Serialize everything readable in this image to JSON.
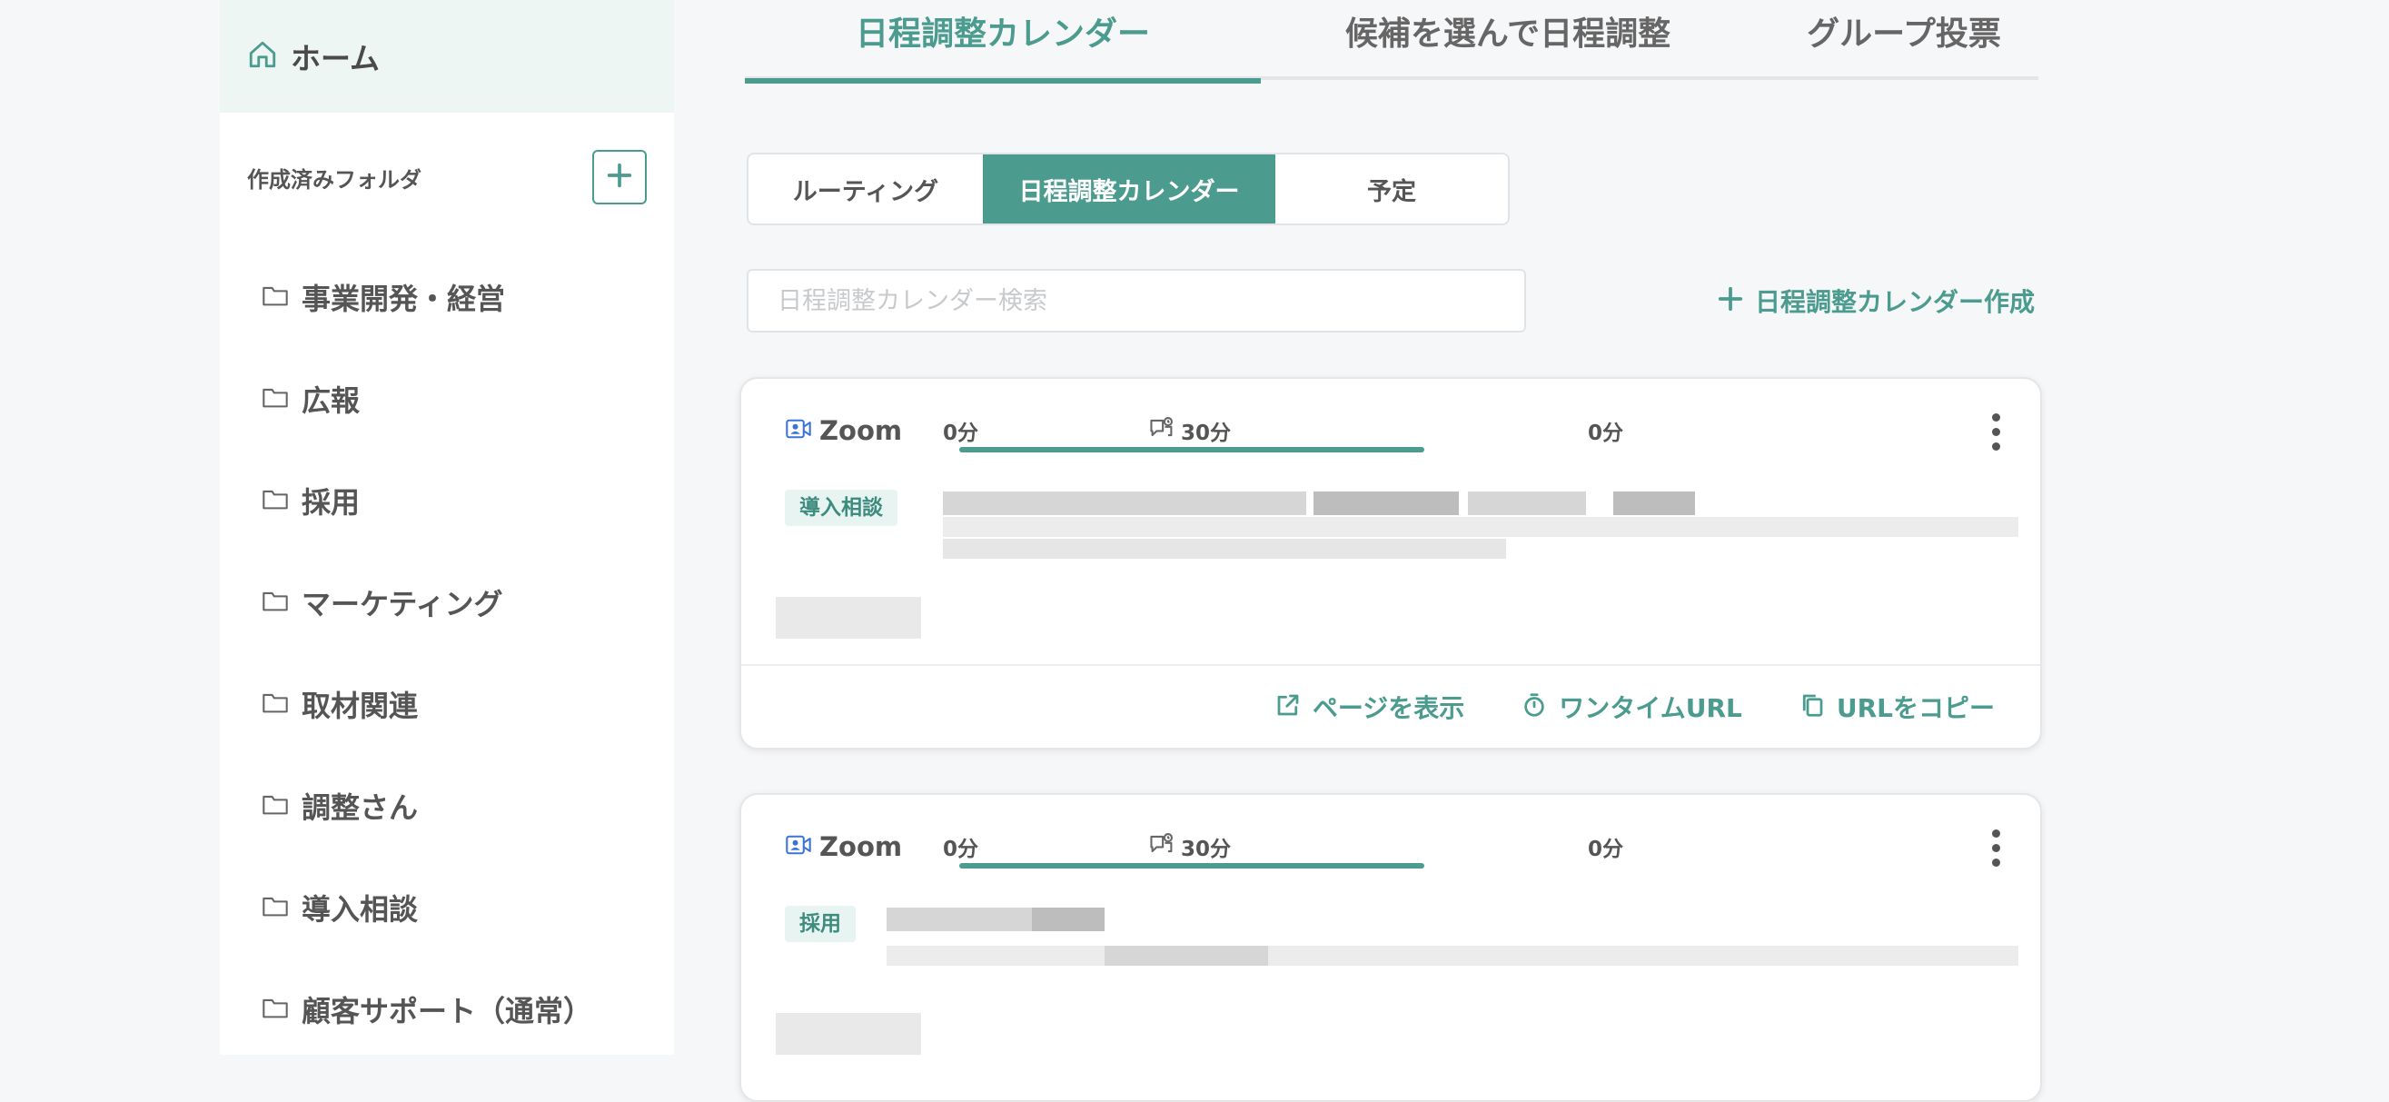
{
  "sidebar": {
    "home_label": "ホーム",
    "folders_title": "作成済みフォルダ",
    "folders": [
      {
        "label": "事業開発・経営"
      },
      {
        "label": "広報"
      },
      {
        "label": "採用"
      },
      {
        "label": "マーケティング"
      },
      {
        "label": "取材関連"
      },
      {
        "label": "調整さん"
      },
      {
        "label": "導入相談"
      },
      {
        "label": "顧客サポート（通常）"
      }
    ]
  },
  "top_tabs": [
    {
      "label": "日程調整カレンダー",
      "active": true
    },
    {
      "label": "候補を選んで日程調整",
      "active": false
    },
    {
      "label": "グループ投票",
      "active": false
    }
  ],
  "segments": [
    {
      "label": "ルーティング",
      "active": false
    },
    {
      "label": "日程調整カレンダー",
      "active": true
    },
    {
      "label": "予定",
      "active": false
    }
  ],
  "search": {
    "placeholder": "日程調整カレンダー検索"
  },
  "create_label": "日程調整カレンダー作成",
  "cards": [
    {
      "platform": "Zoom",
      "before_buffer": "0分",
      "duration": "30分",
      "after_buffer": "0分",
      "tag": "導入相談",
      "actions": {
        "view": "ページを表示",
        "one_time_url": "ワンタイムURL",
        "copy_url": "URLをコピー"
      }
    },
    {
      "platform": "Zoom",
      "before_buffer": "0分",
      "duration": "30分",
      "after_buffer": "0分",
      "tag": "採用"
    }
  ],
  "colors": {
    "accent": "#4b9b8f",
    "tag_bg": "#e8f4f1",
    "home_bg": "#eef6f4"
  },
  "icons": {
    "home": "home-icon",
    "add": "plus-icon",
    "folder": "folder-icon",
    "video": "video-icon",
    "duration": "chat-clock-icon",
    "more": "more-vertical-icon",
    "external": "external-link-icon",
    "timer": "timer-icon",
    "copy": "copy-icon"
  }
}
